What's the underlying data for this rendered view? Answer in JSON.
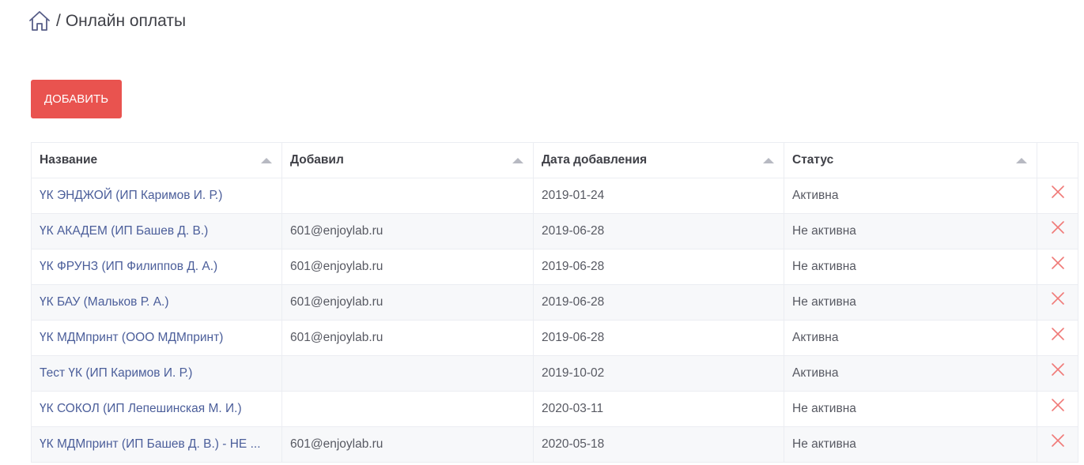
{
  "breadcrumb": {
    "separator": "/",
    "title": "Онлайн оплаты"
  },
  "toolbar": {
    "add_label": "ДОБАВИТЬ"
  },
  "table": {
    "columns": [
      "Название",
      "Добавил",
      "Дата добавления",
      "Статус"
    ],
    "rows": [
      {
        "name": "ҮК ЭНДЖОЙ (ИП Каримов И. Р.)",
        "added_by": "",
        "date": "2019-01-24",
        "status": "Активна"
      },
      {
        "name": "ҮК АКАДЕМ (ИП Башев Д. В.)",
        "added_by": "601@enjoylab.ru",
        "date": "2019-06-28",
        "status": "Не активна"
      },
      {
        "name": "ҮК ФРУНЗ (ИП Филиппов Д. А.)",
        "added_by": "601@enjoylab.ru",
        "date": "2019-06-28",
        "status": "Не активна"
      },
      {
        "name": "ҮК БАУ (Мальков Р. А.)",
        "added_by": "601@enjoylab.ru",
        "date": "2019-06-28",
        "status": "Не активна"
      },
      {
        "name": "ҮК МДМпринт (ООО МДМпринт)",
        "added_by": "601@enjoylab.ru",
        "date": "2019-06-28",
        "status": "Активна"
      },
      {
        "name": "Тест ҮК (ИП Каримов И. Р.)",
        "added_by": "",
        "date": "2019-10-02",
        "status": "Активна"
      },
      {
        "name": "ҮК СОКОЛ (ИП Лепешинская М. И.)",
        "added_by": "",
        "date": "2020-03-11",
        "status": "Не активна"
      },
      {
        "name": "ҮК МДМпринт (ИП Башев Д. В.) - НЕ ...",
        "added_by": "601@enjoylab.ru",
        "date": "2020-05-18",
        "status": "Не активна"
      }
    ]
  },
  "icons": {
    "home": "home-icon",
    "sort": "sort-arrow-icon",
    "delete": "close-icon"
  },
  "colors": {
    "accent": "#e9534f",
    "link": "#4b5e9a",
    "delete": "#f07a78"
  }
}
